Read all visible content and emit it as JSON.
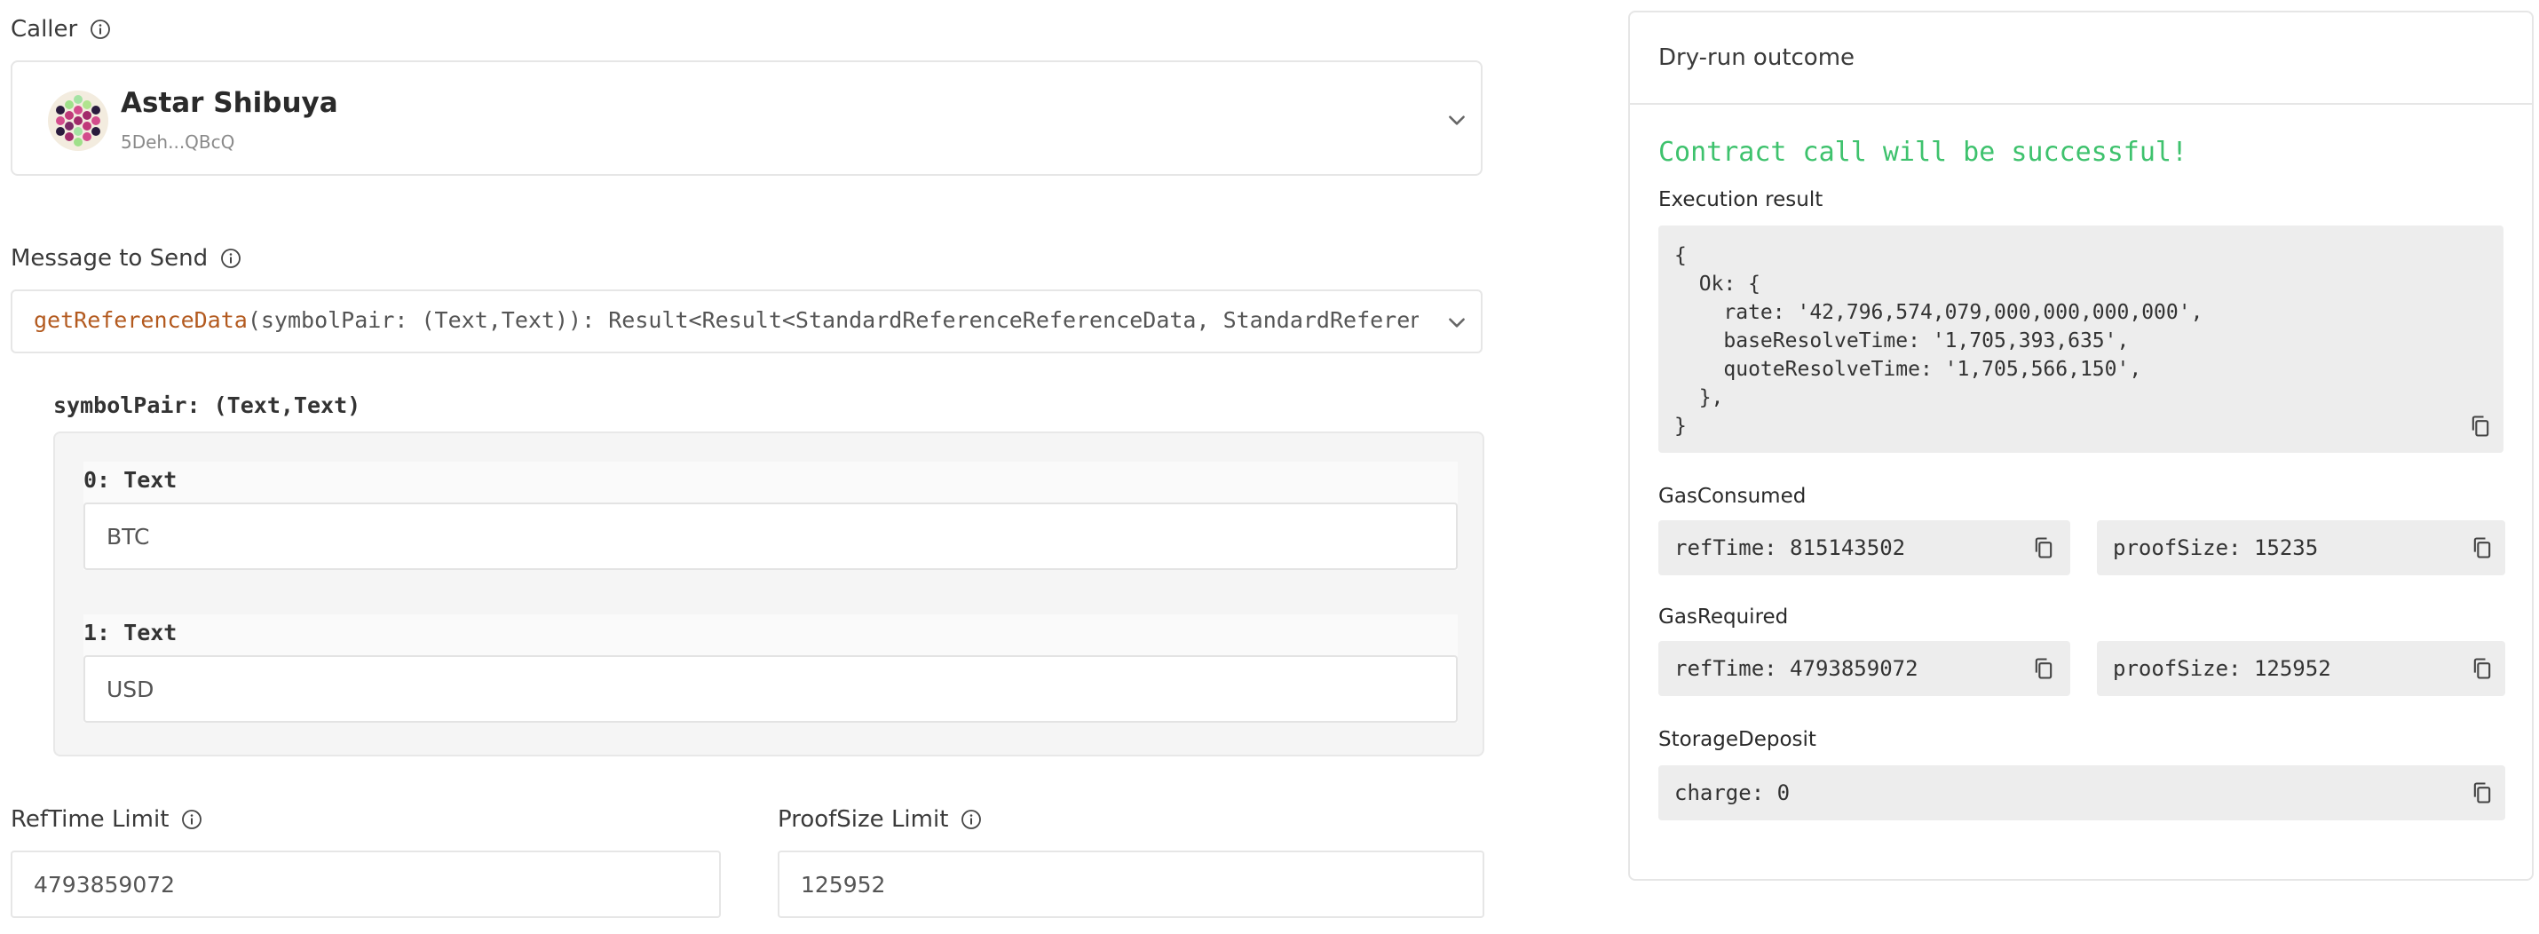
{
  "caller": {
    "label": "Caller",
    "name": "Astar Shibuya",
    "address": "5Deh...QBcQ"
  },
  "message": {
    "label": "Message to Send",
    "fn_name": "getReferenceData",
    "signature": "(symbolPair: (Text,Text)): Result<Result<StandardReferenceReferenceData, StandardReferenceSt"
  },
  "params": {
    "label": "symbolPair: (Text,Text)",
    "items": [
      {
        "label": "0: Text",
        "value": "BTC"
      },
      {
        "label": "1: Text",
        "value": "USD"
      }
    ]
  },
  "limits": {
    "reftime_label": "RefTime Limit",
    "reftime_value": "4793859072",
    "proofsize_label": "ProofSize Limit",
    "proofsize_value": "125952"
  },
  "outcome": {
    "title": "Dry-run outcome",
    "success": "Contract call will be successful!",
    "execution_label": "Execution result",
    "execution_code": "{\n  Ok: {\n    rate: '42,796,574,079,000,000,000,000',\n    baseResolveTime: '1,705,393,635',\n    quoteResolveTime: '1,705,566,150',\n  },\n}",
    "gas_consumed_label": "GasConsumed",
    "gas_consumed_ref": "refTime: 815143502",
    "gas_consumed_proof": "proofSize: 15235",
    "gas_required_label": "GasRequired",
    "gas_required_ref": "refTime: 4793859072",
    "gas_required_proof": "proofSize: 125952",
    "storage_label": "StorageDeposit",
    "storage_value": "charge: 0"
  },
  "colors": {
    "success": "#3ec26d",
    "fn_name": "#b35a1f",
    "code_bg": "#ededed"
  },
  "icons": [
    "info-icon",
    "chevron-down-icon",
    "copy-icon",
    "avatar-identicon"
  ]
}
